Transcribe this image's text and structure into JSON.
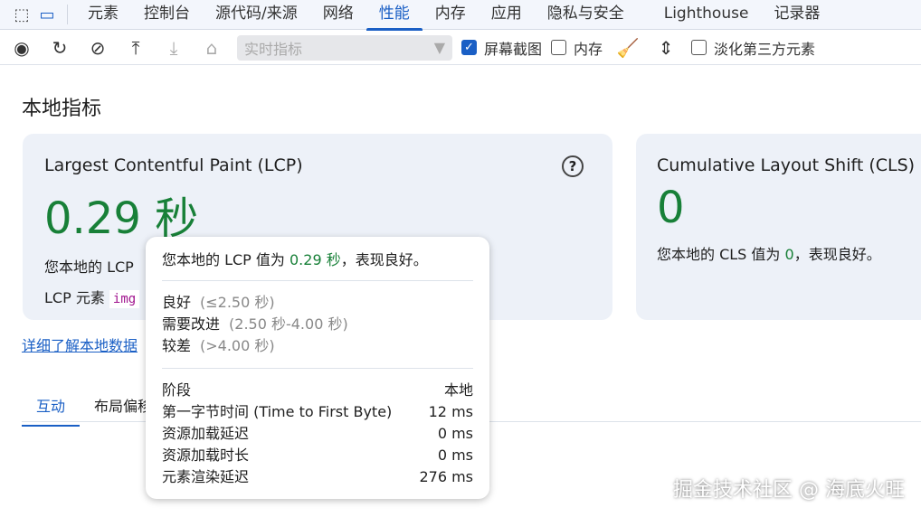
{
  "tabs": [
    "元素",
    "控制台",
    "源代码/来源",
    "网络",
    "性能",
    "内存",
    "应用",
    "隐私与安全",
    "Lighthouse",
    "记录器"
  ],
  "toolbar": {
    "select_placeholder": "实时指标",
    "screenshot_label": "屏幕截图",
    "memory_label": "内存",
    "dim_third_party_label": "淡化第三方元素"
  },
  "heading": "本地指标",
  "lcp_card": {
    "title": "Largest Contentful Paint (LCP)",
    "value": "0.29 秒",
    "desc": "您本地的 LCP",
    "element_label": "LCP 元素",
    "element_code": "img"
  },
  "cls_card": {
    "title": "Cumulative Layout Shift (CLS)",
    "value": "0",
    "desc_pre": "您本地的 CLS 值为 ",
    "desc_val": "0",
    "desc_post": "，表现良好。"
  },
  "learn_more": "详细了解本地数据",
  "lower_tabs": [
    "互动",
    "布局偏移"
  ],
  "tooltip": {
    "summary_pre": "您本地的 LCP 值为 ",
    "summary_val": "0.29 秒",
    "summary_post": "，表现良好。",
    "ratings": [
      {
        "label": "良好",
        "range": "(≤2.50 秒)"
      },
      {
        "label": "需要改进",
        "range": "(2.50 秒-4.00 秒)"
      },
      {
        "label": "较差",
        "range": "(>4.00 秒)"
      }
    ],
    "phase_header": "阶段",
    "local_header": "本地",
    "phases": [
      {
        "name": "第一字节时间 (Time to First Byte)",
        "value": "12 ms"
      },
      {
        "name": "资源加载延迟",
        "value": "0 ms"
      },
      {
        "name": "资源加载时长",
        "value": "0 ms"
      },
      {
        "name": "元素渲染延迟",
        "value": "276 ms"
      }
    ]
  },
  "watermark": "掘金技术社区 @ 海底火旺"
}
